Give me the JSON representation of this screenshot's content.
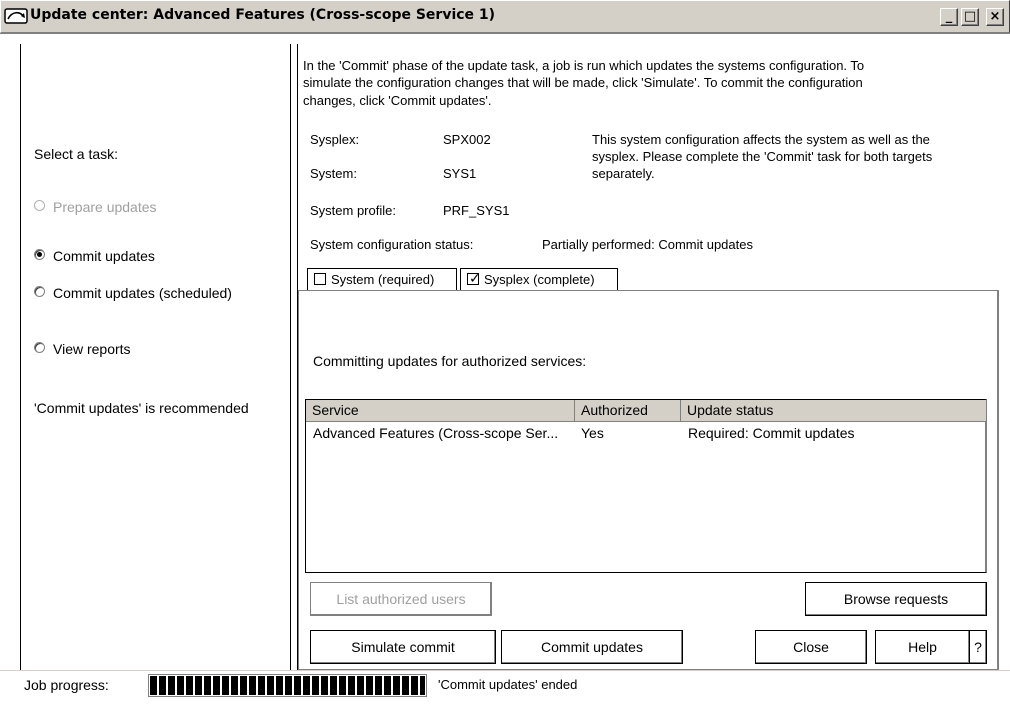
{
  "window": {
    "title": "Update center: Advanced Features (Cross-scope Service 1)",
    "min_glyph": "_",
    "max_glyph": "□",
    "close_glyph": "×"
  },
  "left": {
    "select_task_label": "Select a task:",
    "options": [
      {
        "label": "Prepare updates",
        "checked": false,
        "disabled": true
      },
      {
        "label": "Commit updates",
        "checked": true,
        "disabled": false
      },
      {
        "label": "Commit updates (scheduled)",
        "checked": false,
        "disabled": false
      },
      {
        "label": "View reports",
        "checked": false,
        "disabled": false
      }
    ],
    "recommendation": "'Commit updates' is recommended"
  },
  "main": {
    "intro_lines": [
      "In the 'Commit' phase of the update task, a job is run which updates the systems configuration. To",
      "simulate the configuration changes that will be made, click 'Simulate'. To commit the configuration",
      "changes, click 'Commit updates'."
    ],
    "sysplex_label": "Sysplex:",
    "sysplex_value": "SPX002",
    "system_label": "System:",
    "system_value": "SYS1",
    "profile_label": "System profile:",
    "profile_value": "PRF_SYS1",
    "note_lines": [
      "This system configuration affects the system as well as the",
      "sysplex. Please complete the 'Commit' task for both targets",
      "separately."
    ],
    "config_status_label": "System configuration status:",
    "config_status_value": "Partially performed: Commit updates"
  },
  "tabs": [
    {
      "label": "System (required)",
      "checked": false
    },
    {
      "label": "Sysplex (complete)",
      "checked": true
    }
  ],
  "panel": {
    "heading": "Committing updates for authorized services:",
    "columns": [
      "Service",
      "Authorized",
      "Update status"
    ],
    "rows": [
      {
        "service": "Advanced Features (Cross-scope Ser...",
        "authorized": "Yes",
        "status": "Required: Commit updates"
      }
    ],
    "list_users_button": "List authorized users",
    "browse_button": "Browse requests"
  },
  "actions": {
    "simulate": "Simulate commit",
    "commit": "Commit updates",
    "close": "Close",
    "help": "Help",
    "question": "?"
  },
  "status": {
    "job_progress_label": "Job progress:",
    "progress_fraction": 1.0,
    "message": "'Commit updates' ended"
  }
}
